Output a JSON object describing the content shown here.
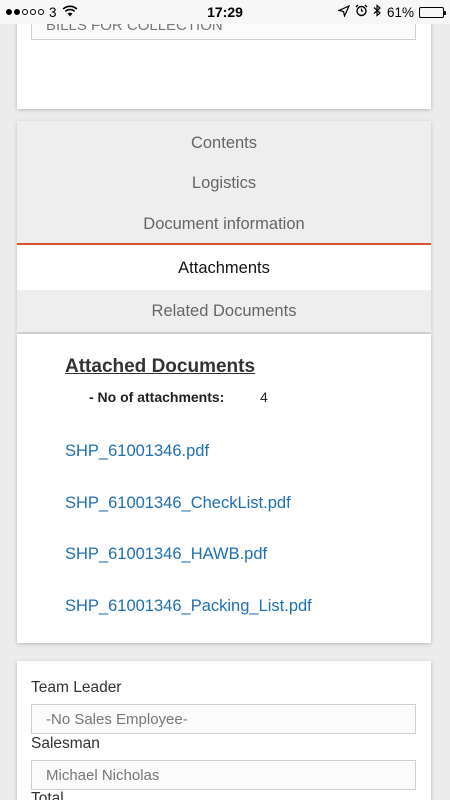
{
  "status_bar": {
    "carrier": "3",
    "time": "17:29",
    "battery": "61%",
    "battery_level": 0.61,
    "icons": [
      "signal-dots-icon",
      "wifi-icon",
      "location-icon",
      "alarm-icon",
      "bluetooth-icon",
      "battery-icon"
    ]
  },
  "top_card": {
    "field_value": "BILLS FOR COLLECTION"
  },
  "tabs": {
    "items": [
      {
        "label": "Contents"
      },
      {
        "label": "Logistics"
      },
      {
        "label": "Document information"
      },
      {
        "label": "Attachments",
        "active": true
      },
      {
        "label": "Related Documents"
      }
    ],
    "accent_color": "#d9542f"
  },
  "attachments": {
    "title": "Attached Documents",
    "count_label": "- No of attachments:",
    "count_value": "4",
    "files": [
      "SHP_61001346.pdf",
      "SHP_61001346_CheckList.pdf",
      "SHP_61001346_HAWB.pdf",
      "SHP_61001346_Packing_List.pdf"
    ],
    "link_color": "#1f6fb2"
  },
  "sales": {
    "team_leader_label": "Team Leader",
    "team_leader_value": "-No Sales Employee-",
    "salesman_label": "Salesman",
    "salesman_value": "Michael Nicholas",
    "total_label": "Total"
  }
}
